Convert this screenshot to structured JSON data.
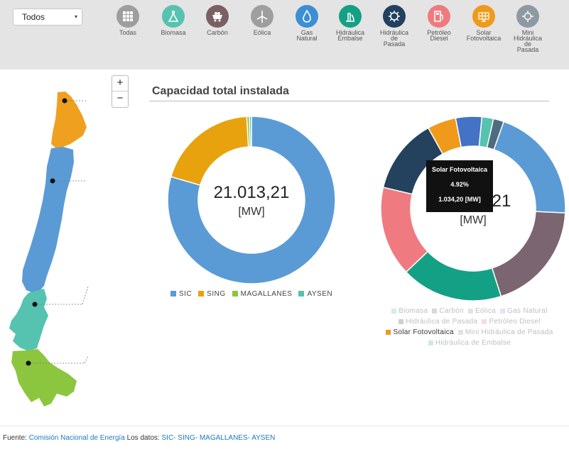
{
  "filter": {
    "selected": "Todos",
    "caret": "▾"
  },
  "categories": [
    {
      "key": "todas",
      "label": "Todas",
      "icon": "grid-icon",
      "color": "#9e9e9e"
    },
    {
      "key": "biomasa",
      "label": "Biomasa",
      "icon": "flask-icon",
      "color": "#56c3b0"
    },
    {
      "key": "carbon",
      "label": "Carbón",
      "icon": "coal-cart-icon",
      "color": "#7a6064"
    },
    {
      "key": "eolica",
      "label": "Eólica",
      "icon": "wind-turbine-icon",
      "color": "#9e9e9e"
    },
    {
      "key": "gas",
      "label": "Gas\nNatural",
      "icon": "flame-icon",
      "color": "#3c8fd3"
    },
    {
      "key": "hidraulica_embalse",
      "label": "Hidráulica\nEmbalse",
      "icon": "dam-icon",
      "color": "#14a085"
    },
    {
      "key": "hidraulica_pasada",
      "label": "Hidráulica\nde\nPasada",
      "icon": "water-wheel-icon",
      "color": "#22405f"
    },
    {
      "key": "petroleo",
      "label": "Petróleo\nDiesel",
      "icon": "fuel-pump-icon",
      "color": "#ef7b80"
    },
    {
      "key": "solar",
      "label": "Solar\nFotovoltaica",
      "icon": "solar-panel-icon",
      "color": "#ef9a1a"
    },
    {
      "key": "mini_hidraulica",
      "label": "Mini\nHidráulica\nde\nPasada",
      "icon": "small-water-wheel-icon",
      "color": "#8d9aa3"
    }
  ],
  "map": {
    "zoom_in": "+",
    "zoom_out": "−"
  },
  "section": {
    "title": "Capacidad total instalada"
  },
  "chart_data": [
    {
      "type": "pie",
      "center_value": "21.013,21",
      "center_unit": "[MW]",
      "series": [
        {
          "name": "SIC",
          "value": 79.5,
          "color": "#5b9bd5"
        },
        {
          "name": "SING",
          "value": 19.6,
          "color": "#e8a20d"
        },
        {
          "name": "MAGALLANES",
          "value": 0.5,
          "color": "#8cc63f"
        },
        {
          "name": "AYSEN",
          "value": 0.4,
          "color": "#56c3b0"
        }
      ]
    },
    {
      "type": "pie",
      "center_value": "21.013,21",
      "center_unit": "[MW]",
      "series": [
        {
          "name": "Eólica",
          "value": 4.5,
          "color": "#4472c4"
        },
        {
          "name": "Biomasa",
          "value": 2.0,
          "color": "#56c3b0"
        },
        {
          "name": "Mini Hidráulica de Pasada",
          "value": 1.8,
          "color": "#4f6b80"
        },
        {
          "name": "Gas Natural",
          "value": 20.0,
          "color": "#5b9bd5"
        },
        {
          "name": "Carbón",
          "value": 19.0,
          "color": "#7a6570"
        },
        {
          "name": "Hidráulica de Embalse",
          "value": 17.5,
          "color": "#14a085"
        },
        {
          "name": "Petróleo Diesel",
          "value": 15.5,
          "color": "#ef7b80"
        },
        {
          "name": "Hidráulica de Pasada",
          "value": 13.0,
          "color": "#24425e"
        },
        {
          "name": "Solar Fotovoltaica",
          "value": 4.92,
          "color": "#ef9a1a"
        }
      ]
    }
  ],
  "legend1": [
    {
      "label": "SIC",
      "color": "#5b9bd5"
    },
    {
      "label": "SING",
      "color": "#e8a20d"
    },
    {
      "label": "MAGALLANES",
      "color": "#8cc63f"
    },
    {
      "label": "AYSEN",
      "color": "#56c3b0"
    }
  ],
  "legend2_rows": [
    [
      {
        "label": "Biomasa",
        "color": "#d3ede8"
      },
      {
        "label": "Carbón",
        "color": "#dcd6d8"
      },
      {
        "label": "Eólica",
        "color": "#e3e3e3"
      },
      {
        "label": "Gas Natural",
        "color": "#dbe8f4"
      }
    ],
    [
      {
        "label": "Hidráulica de Pasada",
        "color": "#c9d0d8"
      },
      {
        "label": "Petróleo Diesel",
        "color": "#f9dcdd"
      }
    ],
    [
      {
        "label": "Solar Fotovoltaica",
        "color": "#ef9a1a",
        "active": true
      },
      {
        "label": "Mini Hidráulica de Pasada",
        "color": "#dfe3e6"
      }
    ],
    [
      {
        "label": "Hidráulica de Embalse",
        "color": "#cde9e4"
      }
    ]
  ],
  "tooltip": {
    "name": "Solar Fotovoltaica",
    "percent": "4.92%",
    "value": "1.034,20 [MW]"
  },
  "footer": {
    "prefix": "Fuente:",
    "source_link": "Comisión Nacional de Energía",
    "mid": "Los datos:",
    "data_links": "SIC- SING- MAGALLANES- AYSEN"
  }
}
